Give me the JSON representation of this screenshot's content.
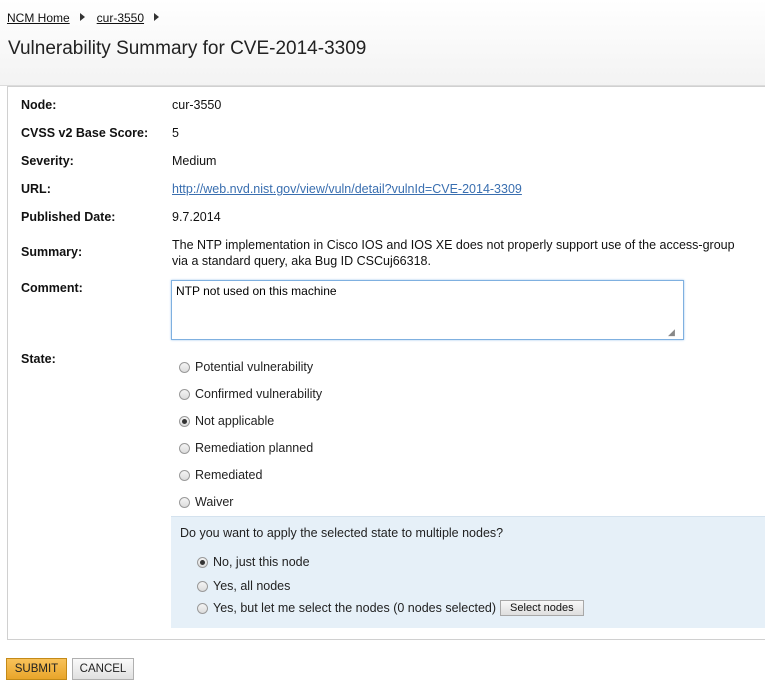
{
  "breadcrumb": {
    "items": [
      {
        "label": "NCM Home"
      },
      {
        "label": "cur-3550"
      }
    ]
  },
  "page": {
    "title": "Vulnerability Summary for CVE-2014-3309"
  },
  "details": {
    "node_label": "Node:",
    "node_value": "cur-3550",
    "cvss_label": "CVSS v2 Base Score:",
    "cvss_value": "5",
    "severity_label": "Severity:",
    "severity_value": "Medium",
    "url_label": "URL:",
    "url_value": "http://web.nvd.nist.gov/view/vuln/detail?vulnId=CVE-2014-3309",
    "published_label": "Published Date:",
    "published_value": "9.7.2014",
    "summary_label": "Summary:",
    "summary_line1": "The NTP implementation in Cisco IOS and IOS XE does not properly support use of the access-group",
    "summary_line2": "via a standard query, aka Bug ID CSCuj66318.",
    "comment_label": "Comment:",
    "comment_value": "NTP not used on this machine",
    "state_label": "State:"
  },
  "state": {
    "selected": "Not applicable",
    "options": [
      {
        "label": "Potential vulnerability",
        "checked": false
      },
      {
        "label": "Confirmed vulnerability",
        "checked": false
      },
      {
        "label": "Not applicable",
        "checked": true
      },
      {
        "label": "Remediation planned",
        "checked": false
      },
      {
        "label": "Remediated",
        "checked": false
      },
      {
        "label": "Waiver",
        "checked": false
      }
    ]
  },
  "multi": {
    "question": "Do you want to apply the selected state to multiple nodes?",
    "options": [
      {
        "label": "No, just this node",
        "checked": true
      },
      {
        "label": "Yes, all nodes",
        "checked": false
      },
      {
        "label": "Yes, but let me select the nodes (0 nodes selected)",
        "checked": false
      }
    ],
    "select_nodes_label": "Select nodes"
  },
  "actions": {
    "submit_label": "SUBMIT",
    "cancel_label": "CANCEL"
  },
  "colors": {
    "accent_submit": "#f0b03a",
    "link": "#3a6fb0",
    "multi_box_bg": "#e6f0f8"
  }
}
